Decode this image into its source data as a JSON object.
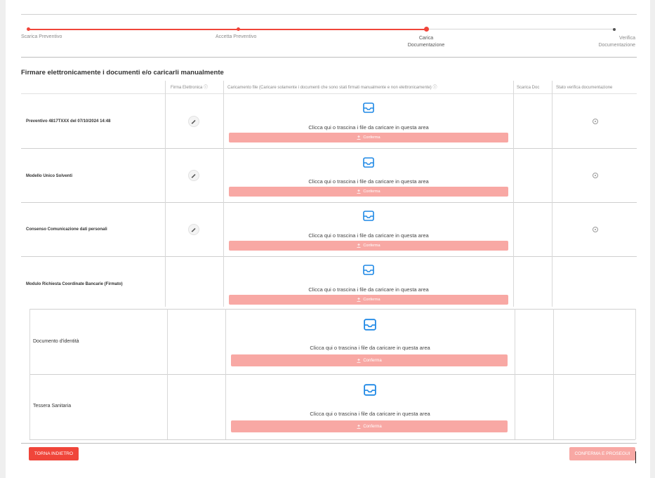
{
  "stepper": {
    "steps": [
      {
        "label": "Scarica Preventivo",
        "state": "done"
      },
      {
        "label": "Accetta Preventivo",
        "state": "done"
      },
      {
        "label": "Carica Documentazione",
        "line1": "Carica",
        "line2": "Documentazione",
        "state": "active"
      },
      {
        "label": "Verifica Documentazione",
        "line1": "Verifica",
        "line2": "Documentazione",
        "state": "pending"
      }
    ]
  },
  "section_title": "Firmare elettronicamente i documenti e/o caricarli manualmente",
  "table": {
    "headers": {
      "sign": "Firma Elettronica ⓘ",
      "upload": "Caricamento file (Caricare solamente i documenti che sono stati firmati manualmente e non elettronicamente) ⓘ",
      "download": "Scarica Doc",
      "status": "Stato verifica documentazione"
    },
    "drop_text": "Clicca qui o trascina i file da caricare in questa area",
    "confirm_label": "Conferma",
    "rows": [
      {
        "label": "Preventivo 4817TXXX del 07/10/2024 14:48"
      },
      {
        "label": "Modello Unico Solventi"
      },
      {
        "label": "Consenso Comunicazione dati personali"
      },
      {
        "label": "Modulo Richiesta Coordinate Bancarie (Firmato)"
      },
      {
        "label": "Documento d'identità"
      },
      {
        "label": "Tessera Sanitaria"
      }
    ]
  },
  "footer": {
    "back_label": "TORNA INDIETRO",
    "next_label": "CONFERMA E PROSEGUI"
  },
  "colors": {
    "accent": "#f0453a",
    "accent_disabled": "#f8a8a4",
    "upload_icon": "#1e88e5"
  }
}
